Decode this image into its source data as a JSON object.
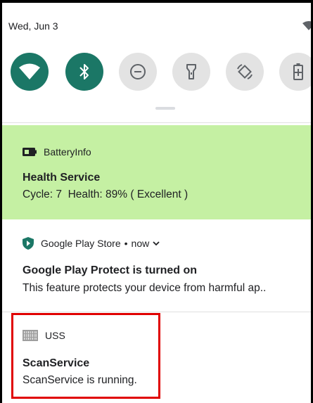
{
  "status_bar": {
    "date": "Wed, Jun 3",
    "wifi_icon": "wifi-icon"
  },
  "quick_settings": {
    "tiles": [
      {
        "name": "wifi",
        "icon": "wifi-icon",
        "state": "on"
      },
      {
        "name": "bluetooth",
        "icon": "bluetooth-icon",
        "state": "on"
      },
      {
        "name": "do-not-disturb",
        "icon": "minus-circle-icon",
        "state": "off"
      },
      {
        "name": "flashlight",
        "icon": "flashlight-icon",
        "state": "off"
      },
      {
        "name": "auto-rotate",
        "icon": "rotate-icon",
        "state": "off"
      },
      {
        "name": "battery-saver",
        "icon": "battery-plus-icon",
        "state": "off"
      }
    ],
    "colors": {
      "on": "#1b7766",
      "off": "#e3e3e3"
    }
  },
  "notifications": [
    {
      "app": "BatteryInfo",
      "icon": "battery-icon",
      "title": "Health Service",
      "text": "Cycle: 7  Health: 89% ( Excellent )",
      "background": "#c5f0a3"
    },
    {
      "app": "Google Play Store",
      "separator": "•",
      "time": "now",
      "icon": "play-protect-shield-icon",
      "title": "Google Play Protect is turned on",
      "text": "This feature protects your device from harmful ap.."
    },
    {
      "app": "USS",
      "icon": "barcode-icon",
      "title": "ScanService",
      "text": "ScanService is running.",
      "highlight_color": "#e00000"
    }
  ]
}
